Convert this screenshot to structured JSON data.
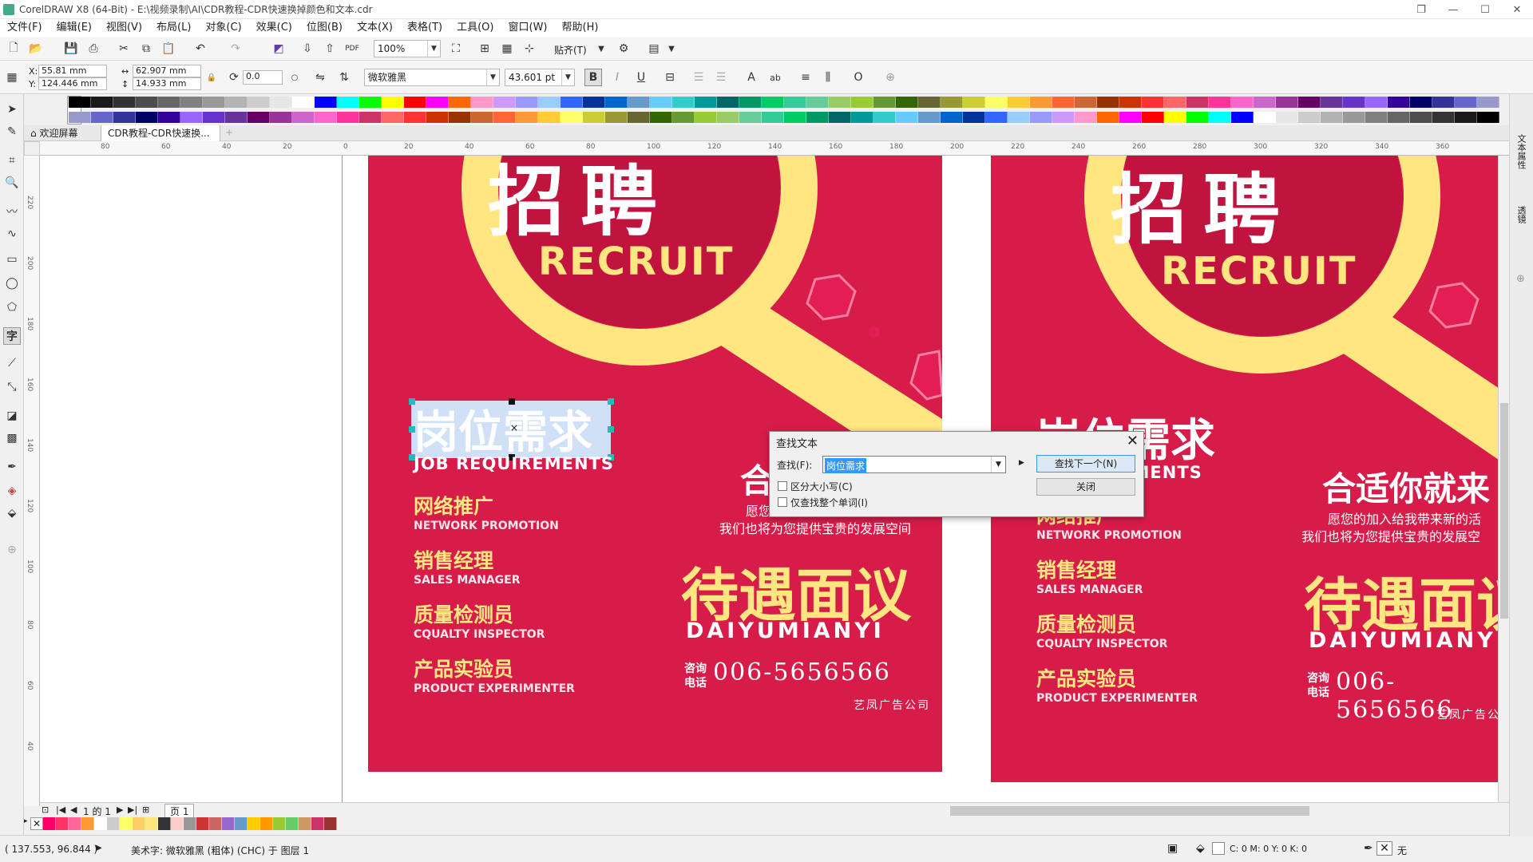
{
  "window": {
    "title": "CorelDRAW X8 (64-Bit) - E:\\视频录制\\AI\\CDR教程-CDR快速换掉颜色和文本.cdr"
  },
  "menu": [
    "文件(F)",
    "编辑(E)",
    "视图(V)",
    "布局(L)",
    "对象(C)",
    "效果(C)",
    "位图(B)",
    "文本(X)",
    "表格(T)",
    "工具(O)",
    "窗口(W)",
    "帮助(H)"
  ],
  "toolbar": {
    "zoom": "100%",
    "snap_label": "贴齐(T)"
  },
  "props": {
    "x_label": "X:",
    "x_value": "55.81 mm",
    "y_label": "Y:",
    "y_value": "124.446 mm",
    "w_value": "62.907 mm",
    "h_value": "14.933 mm",
    "rotation": "0.0",
    "font_name": "微软雅黑",
    "font_size": "43.601 pt",
    "bold": "B",
    "italic": "I",
    "underline": "U"
  },
  "tabs": {
    "welcome": "欢迎屏幕",
    "document": "CDR教程-CDR快速换..."
  },
  "ruler_h": [
    "80",
    "60",
    "40",
    "20",
    "0",
    "20",
    "40",
    "60",
    "80",
    "100",
    "120",
    "140",
    "160",
    "180",
    "200",
    "220",
    "240",
    "260",
    "280",
    "300",
    "320",
    "340",
    "360"
  ],
  "ruler_v": [
    "220",
    "200",
    "180",
    "160",
    "140",
    "120",
    "100",
    "80",
    "60",
    "40"
  ],
  "poster_left": {
    "recruit": "RECRUIT",
    "job_title": "岗位需求",
    "job_en": "JOB REQUIREMENTS",
    "positions": [
      {
        "cn": "网络推广",
        "en": "NETWORK PROMOTION"
      },
      {
        "cn": "销售经理",
        "en": "SALES MANAGER"
      },
      {
        "cn": "质量检测员",
        "en": "CQUALTY INSPECTOR"
      },
      {
        "cn": "产品实验员",
        "en": "PRODUCT EXPERIMENTER"
      }
    ],
    "heading_partial": "合适",
    "desc1": "愿您的加入",
    "desc2": "我们也将为您提供宝贵的发展空间",
    "salary_cn": "待遇面议",
    "salary_en": "DAIYUMIANYI",
    "contact_label1": "咨询",
    "contact_label2": "电话",
    "phone": "006-5656566",
    "company": "艺凤广告公司"
  },
  "poster_right": {
    "recruit": "RECRUIT",
    "job_title": "岗位需求",
    "job_en": "REMENTS",
    "heading": "合适你就来",
    "desc1": "愿您的加入给我带来新的活",
    "desc2": "我们也将为您提供宝贵的发展空",
    "positions": [
      {
        "cn": "网络推广",
        "en": "NETWORK PROMOTION"
      },
      {
        "cn": "销售经理",
        "en": "SALES MANAGER"
      },
      {
        "cn": "质量检测员",
        "en": "CQUALTY INSPECTOR"
      },
      {
        "cn": "产品实验员",
        "en": "PRODUCT EXPERIMENTER"
      }
    ],
    "salary_cn": "待遇面议",
    "salary_en": "DAIYUMIANY",
    "contact_label1": "咨询",
    "contact_label2": "电话",
    "phone": "006-5656566",
    "company": "艺凤广告公"
  },
  "dialog": {
    "title": "查找文本",
    "find_label": "查找(F):",
    "find_value": "岗位需求",
    "find_next": "查找下一个(N)",
    "close": "关闭",
    "match_case": "区分大小写(C)",
    "whole_word": "仅查找整个单词(I)"
  },
  "pagebar": {
    "page_info": "1 的 1",
    "page_tab": "页 1"
  },
  "status": {
    "coords": "( 137.553, 96.844 )",
    "object_info": "美术字: 微软雅黑 (粗体) (CHC) 于 图层 1",
    "fill": "C: 0 M: 0 Y: 0 K: 0",
    "outline": "无"
  },
  "right_dock": {
    "tab1": "文本属性",
    "tab2": "透镜"
  },
  "colors": {
    "poster_red": "#d81c4a",
    "accent_yellow": "#ffe680",
    "selection_blue": "#cfe0f7"
  },
  "palette_top": [
    "#000000",
    "#1a1a1a",
    "#333333",
    "#4d4d4d",
    "#666666",
    "#808080",
    "#999999",
    "#b3b3b3",
    "#cccccc",
    "#e6e6e6",
    "#ffffff",
    "#0000ff",
    "#00ffff",
    "#00ff00",
    "#ffff00",
    "#ff0000",
    "#ff00ff",
    "#ff6600",
    "#ff99cc",
    "#cc99ff",
    "#9999ff",
    "#99ccff",
    "#3366ff",
    "#003399",
    "#0066cc",
    "#6699cc",
    "#66ccff",
    "#33cccc",
    "#009999",
    "#006666",
    "#009966",
    "#00cc66",
    "#33cc99",
    "#66cc99",
    "#99cc66",
    "#99cc33",
    "#669933",
    "#336600",
    "#666633",
    "#999933",
    "#cccc33",
    "#ffff66",
    "#ffcc33",
    "#ff9933",
    "#ff6633",
    "#cc6633",
    "#993300",
    "#cc3300",
    "#ff3333",
    "#ff6666",
    "#cc3366",
    "#ff3399",
    "#ff66cc",
    "#cc66cc",
    "#993399",
    "#660066",
    "#663399",
    "#6633cc",
    "#9966ff",
    "#330099",
    "#000066",
    "#333399",
    "#6666cc",
    "#9999cc"
  ],
  "palette_bottom": [
    "#ff0066",
    "#ff3366",
    "#ff6699",
    "#ff9933",
    "#ffffff",
    "#cccccc",
    "#ffff66",
    "#ffcc66",
    "#ffe680",
    "#333333",
    "#ffcccc",
    "#999999",
    "#cc3333",
    "#cc6666",
    "#9966cc",
    "#6699cc",
    "#ffcc00",
    "#ff9900",
    "#99cc33",
    "#66cc66",
    "#cc9966",
    "#cc3366",
    "#993333"
  ]
}
